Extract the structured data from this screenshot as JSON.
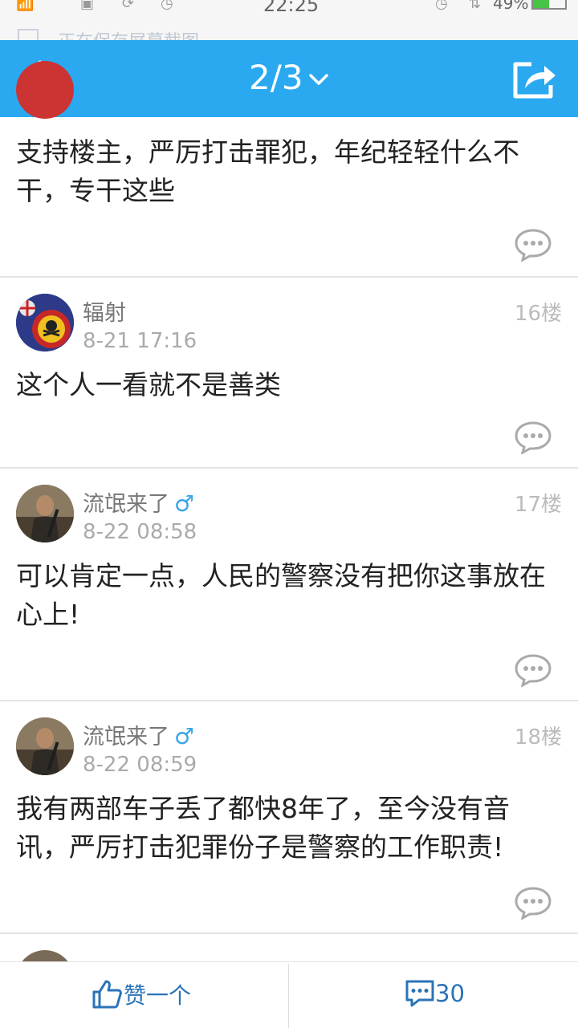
{
  "status_bar": {
    "time": "22:25",
    "battery": "49%",
    "battery_level": 0.49,
    "notification": "正在保存屏幕截图"
  },
  "header": {
    "page_indicator": "2/3"
  },
  "posts": [
    {
      "text": "支持楼主，严厉打击罪犯，年纪轻轻什么不干，专干这些"
    },
    {
      "username": "辐射",
      "date": "8-21 17:16",
      "floor": "16楼",
      "text": "这个人一看就不是善类"
    },
    {
      "username": "流氓来了",
      "gender": "♂",
      "date": "8-22 08:58",
      "floor": "17楼",
      "text": "可以肯定一点，人民的警察没有把你这事放在心上!"
    },
    {
      "username": "流氓来了",
      "gender": "♂",
      "date": "8-22 08:59",
      "floor": "18楼",
      "text": "我有两部车子丢了都快8年了，至今没有音讯，严厉打击犯罪份子是警察的工作职责!"
    }
  ],
  "bottom_bar": {
    "like_label": "赞一个",
    "comment_count": "30"
  },
  "colors": {
    "accent": "#2aa9f1",
    "link": "#2a73b8",
    "male": "#3aa6e8"
  }
}
